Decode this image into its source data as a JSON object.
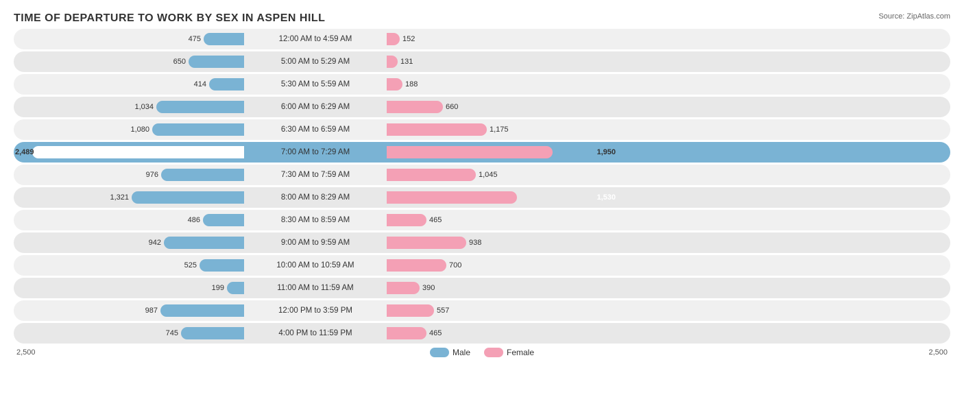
{
  "title": "TIME OF DEPARTURE TO WORK BY SEX IN ASPEN HILL",
  "source": "Source: ZipAtlas.com",
  "max_value": 2500,
  "axis_labels": {
    "left": "2,500",
    "right": "2,500"
  },
  "legend": {
    "male_label": "Male",
    "female_label": "Female"
  },
  "rows": [
    {
      "label": "12:00 AM to 4:59 AM",
      "male": 475,
      "female": 152
    },
    {
      "label": "5:00 AM to 5:29 AM",
      "male": 650,
      "female": 131
    },
    {
      "label": "5:30 AM to 5:59 AM",
      "male": 414,
      "female": 188
    },
    {
      "label": "6:00 AM to 6:29 AM",
      "male": 1034,
      "female": 660
    },
    {
      "label": "6:30 AM to 6:59 AM",
      "male": 1080,
      "female": 1175
    },
    {
      "label": "7:00 AM to 7:29 AM",
      "male": 2489,
      "female": 1950,
      "highlight_male": true,
      "highlight_female": true
    },
    {
      "label": "7:30 AM to 7:59 AM",
      "male": 976,
      "female": 1045
    },
    {
      "label": "8:00 AM to 8:29 AM",
      "male": 1321,
      "female": 1530,
      "highlight_female": true
    },
    {
      "label": "8:30 AM to 8:59 AM",
      "male": 486,
      "female": 465
    },
    {
      "label": "9:00 AM to 9:59 AM",
      "male": 942,
      "female": 938
    },
    {
      "label": "10:00 AM to 10:59 AM",
      "male": 525,
      "female": 700
    },
    {
      "label": "11:00 AM to 11:59 AM",
      "male": 199,
      "female": 390
    },
    {
      "label": "12:00 PM to 3:59 PM",
      "male": 987,
      "female": 557
    },
    {
      "label": "4:00 PM to 11:59 PM",
      "male": 745,
      "female": 465
    }
  ]
}
